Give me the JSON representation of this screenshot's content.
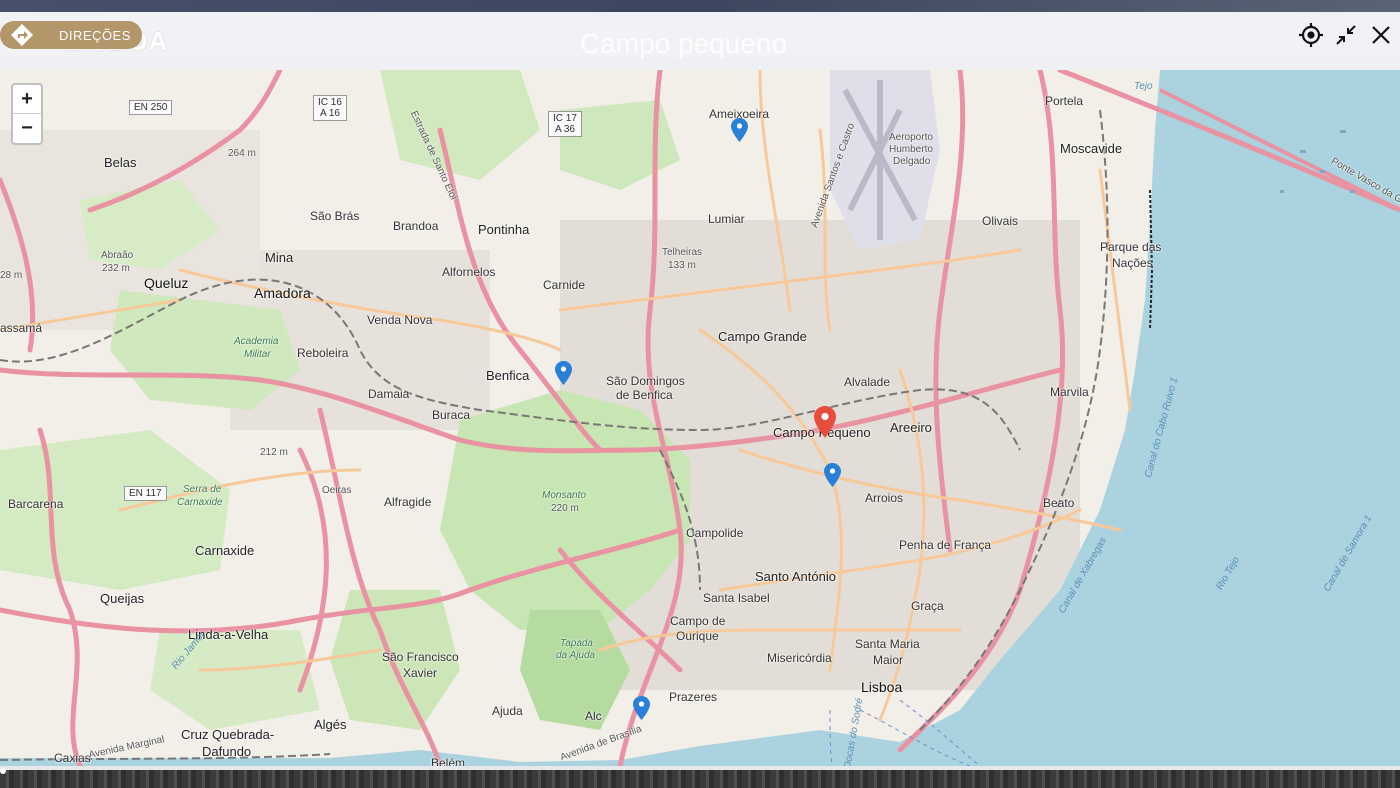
{
  "header": {
    "directions_label": "DIREÇÕES",
    "city_ghost": "LISBOA",
    "title_ghost": "Campo pequeno"
  },
  "icons": {
    "locate": "crosshair-icon",
    "minimize": "collapse-icon",
    "close": "close-icon",
    "directions": "directions-sign-icon"
  },
  "zoom": {
    "in": "+",
    "out": "−"
  },
  "colors": {
    "accent": "#b4966b",
    "water": "#aad3df",
    "park": "#c8e6b4",
    "road_major": "#e892a2",
    "road_secondary": "#f7c99a",
    "marker_active": "#e74c3c",
    "marker": "#2a7fd6"
  },
  "map_labels": {
    "ameixoeira": "Ameixoeira",
    "portela": "Portela",
    "moscavide": "Moscavide",
    "belas": "Belas",
    "lumiar": "Lumiar",
    "olivais": "Olivais",
    "pontinha": "Pontinha",
    "brandoa": "Brandoa",
    "sao_bras": "São Brás",
    "mina": "Mina",
    "telheiras": "Telheiras",
    "m133": "133 m",
    "parque_nacoes": "Parque das",
    "parque_nacoes2": "Nações",
    "queluz": "Queluz",
    "amadora": "Amadora",
    "alfornelos": "Alfornelos",
    "carnide": "Carnide",
    "abraao": "Abraão",
    "m232": "232 m",
    "m264": "264 m",
    "m28": "28 m",
    "massama": "assamá",
    "venda_nova": "Venda Nova",
    "campo_grande": "Campo Grande",
    "academia": "Academia",
    "militar": "Militar",
    "reboleira": "Reboleira",
    "benfica": "Benfica",
    "sao_domingos": "São Domingos",
    "de_benfica": "de Benfica",
    "alvalade": "Alvalade",
    "marvila": "Marvila",
    "damaia": "Damaia",
    "buraca": "Buraca",
    "campo_pequeno": "Campo Pequeno",
    "areeiro": "Areeiro",
    "m212": "212 m",
    "arroios": "Arroios",
    "beato": "Beato",
    "barcarena": "Barcarena",
    "serra1": "Serra de",
    "serra2": "Carnaxide",
    "oeiras": "Oeiras",
    "alfragide": "Alfragide",
    "monsanto": "Monsanto",
    "m220": "220 m",
    "campolide": "Campolide",
    "carnaxide": "Carnaxide",
    "penha": "Penha de França",
    "santo_antonio": "Santo António",
    "queijas": "Queijas",
    "santa_isabel": "Santa Isabel",
    "graca": "Graça",
    "linda": "Linda-a-Velha",
    "campo_ourique1": "Campo de",
    "campo_ourique2": "Ourique",
    "santa_maria1": "Santa Maria",
    "santa_maria2": "Maior",
    "sao_francisco1": "São Francisco",
    "sao_francisco2": "Xavier",
    "tapada1": "Tapada",
    "tapada2": "da Ajuda",
    "misericordia": "Misericórdia",
    "lisboa": "Lisboa",
    "prazeres": "Prazeres",
    "ajuda": "Ajuda",
    "alcantara": "Alc",
    "alges": "Algés",
    "cruz1": "Cruz Quebrada-",
    "cruz2": "Dafundo",
    "caxias": "Caxias",
    "belem": "Belém",
    "aeroporto1": "Aeroporto",
    "aeroporto2": "Humberto",
    "aeroporto3": "Delgado",
    "rio_tejo": "Rio Tejo",
    "canal_cabo": "Canal do Cabo Ruivo 1",
    "canal_xabregas": "Canal de Xabregas",
    "canal_samora": "Canal de Samora 1",
    "ponte": "Ponte Vasco da Gama",
    "estrada_eloi": "Estrada de Santo Eloi",
    "av_santos": "Avenida Santos e Castro",
    "av_marginal": "Avenida Marginal",
    "av_brasilia": "Avenida de Brasília",
    "docas": "Docas do Sodré",
    "rio_jamor": "Rio Jamor",
    "tejo_top": "Tejo"
  },
  "shields": {
    "en250": "EN 250",
    "ic16a": "IC 16",
    "ic16b": "A 16",
    "ic17a": "IC 17",
    "ic17b": "A 36",
    "en117": "EN 117"
  }
}
